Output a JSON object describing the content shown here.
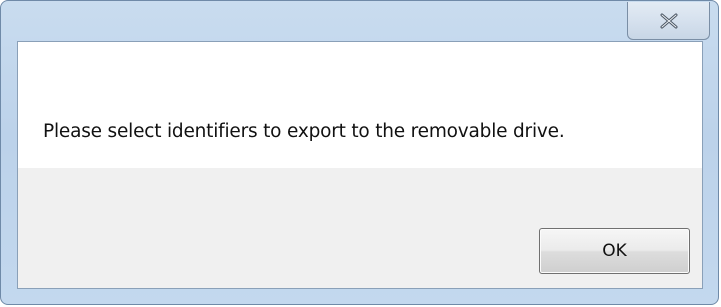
{
  "titlebar": {
    "close_icon": "close-icon"
  },
  "dialog": {
    "message": "Please select identifiers to export to the removable drive.",
    "ok_label": "OK"
  },
  "colors": {
    "frame": "#bcd2ea",
    "button_area": "#f0f0f0",
    "text": "#111111"
  }
}
